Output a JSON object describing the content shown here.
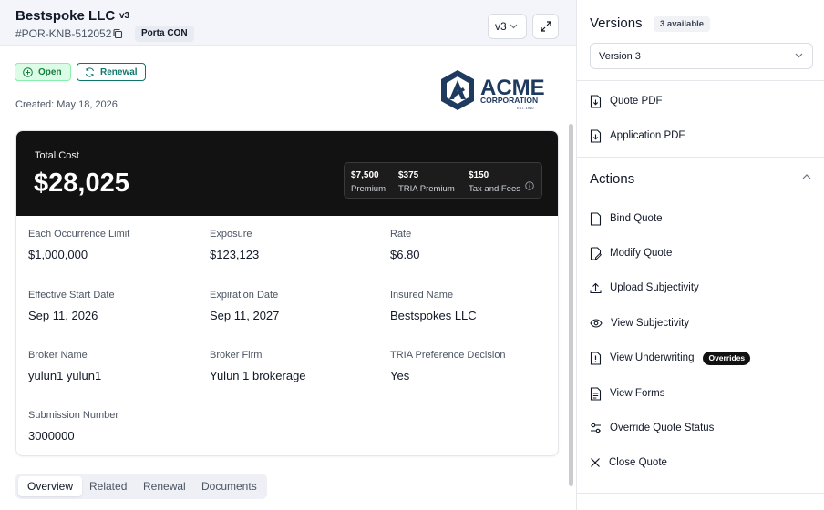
{
  "header": {
    "title": "Bestspoke LLC",
    "version_badge": "v3",
    "quote_id": "#POR-KNB-512052",
    "tag": "Porta CON",
    "version_select": "v3"
  },
  "status": {
    "open": "Open",
    "renewal": "Renewal",
    "created": "Created: May 18, 2026"
  },
  "logo": {
    "name": "ACME",
    "sub": "CORPORATION",
    "est": "EST. 1940",
    "color": "#1f3a5f"
  },
  "cost": {
    "label": "Total Cost",
    "value": "$28,025",
    "breakdown": [
      {
        "amount": "$7,500",
        "label": "Premium"
      },
      {
        "amount": "$375",
        "label": "TRIA Premium"
      },
      {
        "amount": "$150",
        "label": "Tax and Fees"
      }
    ]
  },
  "fields": [
    {
      "label": "Each Occurrence Limit",
      "value": "$1,000,000"
    },
    {
      "label": "Exposure",
      "value": "$123,123"
    },
    {
      "label": "Rate",
      "value": "$6.80"
    },
    {
      "label": "Effective Start Date",
      "value": "Sep 11, 2026"
    },
    {
      "label": "Expiration Date",
      "value": "Sep 11, 2027"
    },
    {
      "label": "Insured Name",
      "value": "Bestspokes LLC"
    },
    {
      "label": "Broker Name",
      "value": "yulun1 yulun1"
    },
    {
      "label": "Broker Firm",
      "value": "Yulun 1 brokerage"
    },
    {
      "label": "TRIA Preference Decision",
      "value": "Yes"
    },
    {
      "label": "Submission Number",
      "value": "3000000"
    }
  ],
  "tabs": [
    {
      "label": "Overview",
      "active": true
    },
    {
      "label": "Related",
      "active": false
    },
    {
      "label": "Renewal",
      "active": false
    },
    {
      "label": "Documents",
      "active": false
    }
  ],
  "versions": {
    "title": "Versions",
    "available": "3 available",
    "selected": "Version 3"
  },
  "documents": [
    {
      "label": "Quote PDF",
      "icon": "file-download-icon"
    },
    {
      "label": "Application PDF",
      "icon": "file-download-icon"
    }
  ],
  "actions": {
    "title": "Actions",
    "items": [
      {
        "label": "Bind Quote",
        "icon": "file-icon"
      },
      {
        "label": "Modify Quote",
        "icon": "file-edit-icon"
      },
      {
        "label": "Upload Subjectivity",
        "icon": "upload-icon"
      },
      {
        "label": "View Subjectivity",
        "icon": "eye-icon"
      },
      {
        "label": "View Underwriting",
        "icon": "alert-file-icon",
        "badge": "Overrides"
      },
      {
        "label": "View Forms",
        "icon": "document-icon"
      },
      {
        "label": "Override Quote Status",
        "icon": "sliders-icon"
      },
      {
        "label": "Close Quote",
        "icon": "close-icon"
      }
    ]
  },
  "colors": {
    "open_green": "#15803d",
    "renewal_teal": "#0f766e",
    "card_dark": "#121212"
  }
}
